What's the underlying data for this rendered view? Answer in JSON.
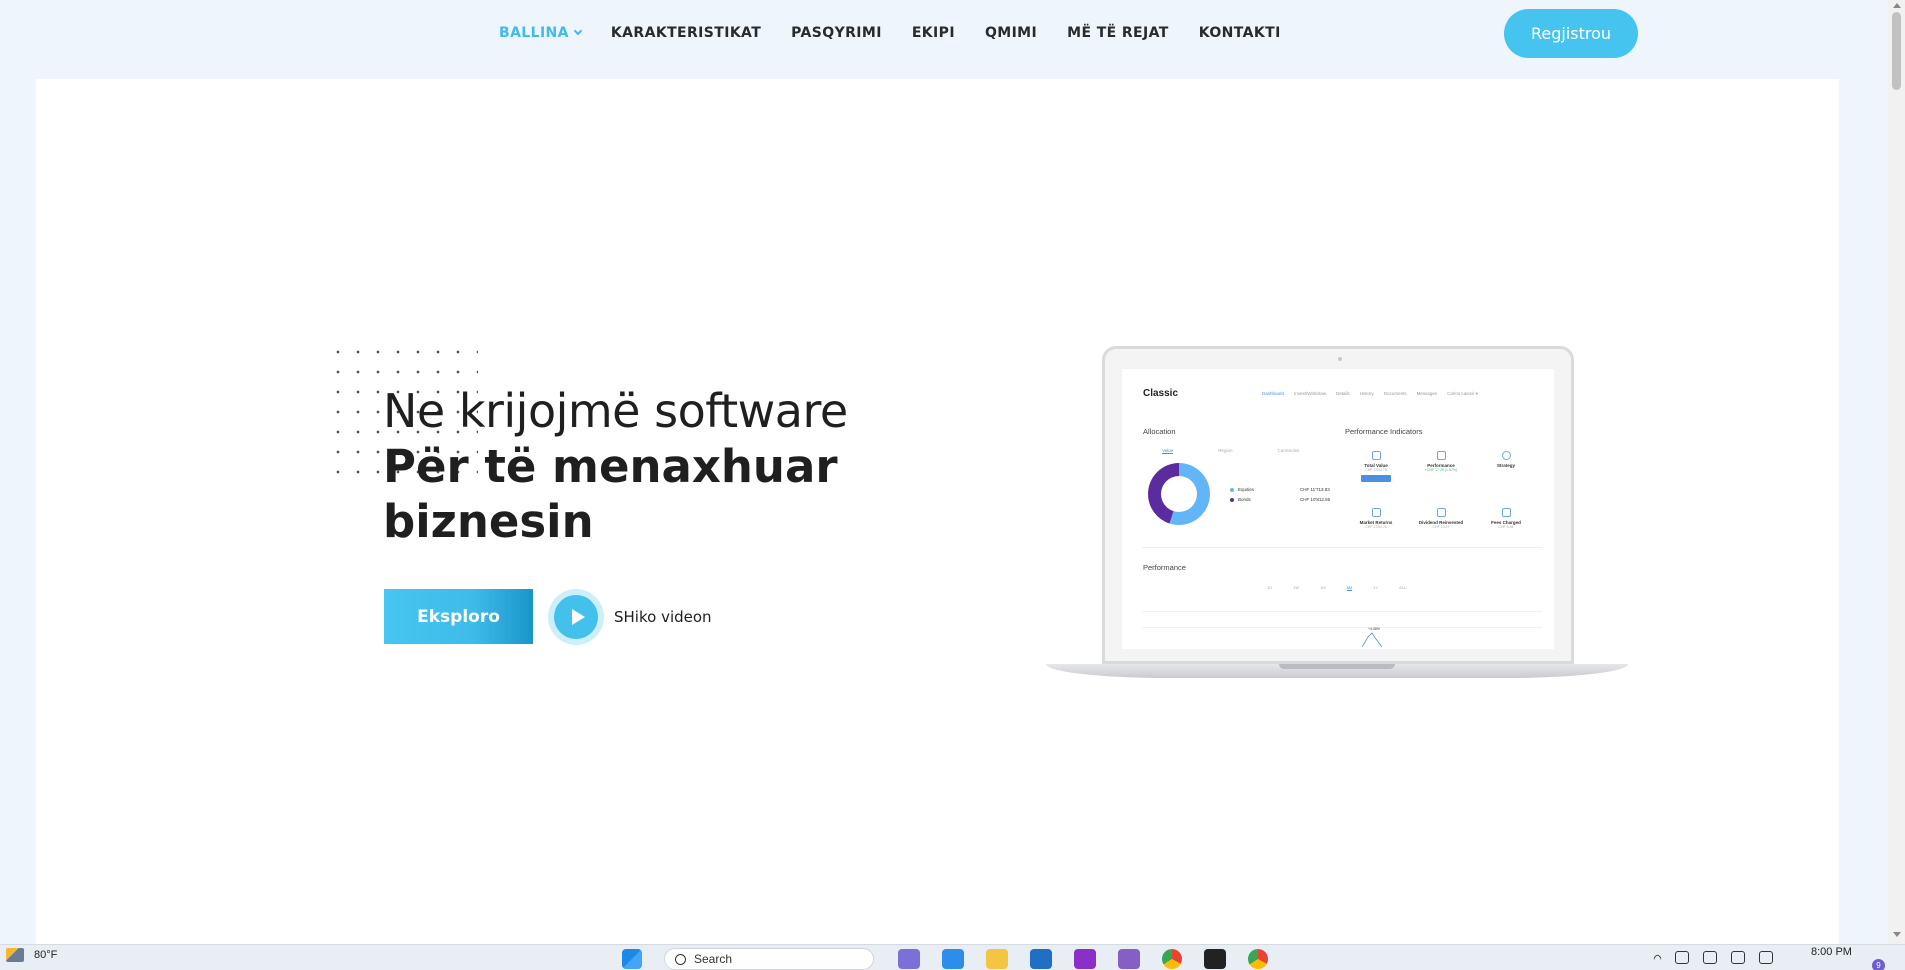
{
  "nav": {
    "items": [
      {
        "label": "BALLINA",
        "active": true
      },
      {
        "label": "KARAKTERISTIKAT"
      },
      {
        "label": "PASQYRIMI"
      },
      {
        "label": "EKIPI"
      },
      {
        "label": "QMIMI"
      },
      {
        "label": "MË TË REJAT"
      },
      {
        "label": "KONTAKTI"
      }
    ],
    "register_label": "Regjistrou"
  },
  "hero": {
    "line1": "Ne krijojmë software",
    "line2": "Për të menaxhuar",
    "line3": "biznesin",
    "explore_label": "Eksploro",
    "video_label": "SHiko videon"
  },
  "dashboard": {
    "title": "Classic",
    "nav": [
      "Dashboard",
      "Invest/Withdraw",
      "Details",
      "History",
      "Documents",
      "Messages",
      "Carlos Laissir ▾"
    ],
    "allocation_label": "Allocation",
    "allocation_tabs": [
      "Value",
      "Region",
      "Currencies"
    ],
    "legend": [
      {
        "name": "Equities",
        "value": "CHF 11'713.83"
      },
      {
        "name": "Bonds",
        "value": "CHF 10'812.85"
      }
    ],
    "indicators_label": "Performance Indicators",
    "indicators": [
      {
        "name": "Total Value",
        "sub": "CHF 1'504.75"
      },
      {
        "name": "Performance",
        "sub": "+CHF 17.28 (1.57%)"
      },
      {
        "name": "Strategy",
        "sub": ""
      },
      {
        "name": "Market Returns",
        "sub": "CHF 1'054.75"
      },
      {
        "name": "Dividend Reinvested",
        "sub": "CHF 13.37"
      },
      {
        "name": "Fees Charged",
        "sub": "CHF 0.44"
      }
    ],
    "performance_label": "Performance",
    "performance_tabs": [
      "1D",
      "1W",
      "1M",
      "6M",
      "1Y",
      "ALL"
    ],
    "chart_peak_label": "+4.08%",
    "colors": {
      "equities": "#62b6f7",
      "bonds": "#5a2ca0"
    }
  },
  "taskbar": {
    "temperature": "80°F",
    "search_placeholder": "Search",
    "time": "8:00 PM",
    "notification_count": "9"
  },
  "colors": {
    "accent": "#44c4ee",
    "background": "#eef5fd"
  }
}
